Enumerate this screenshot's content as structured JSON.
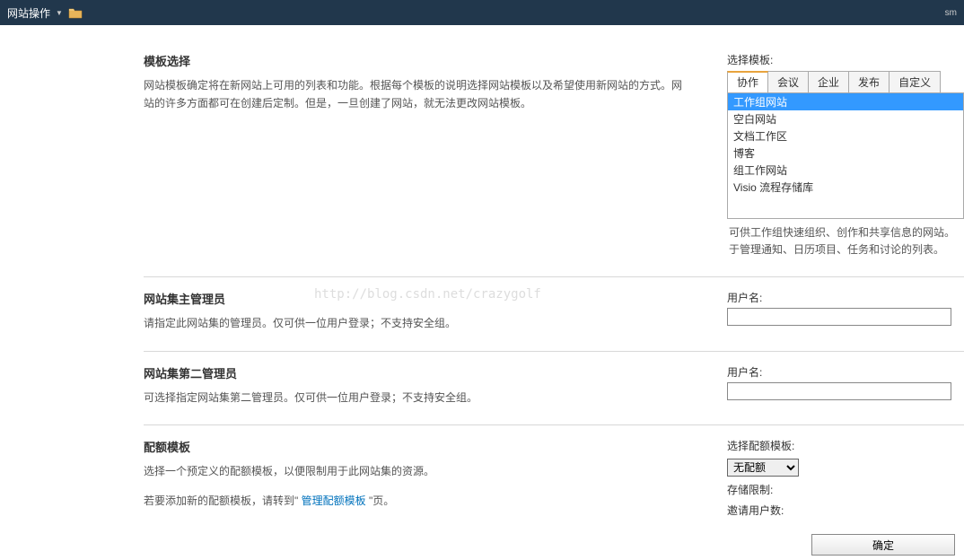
{
  "topbar": {
    "site_actions_label": "网站操作",
    "right_text": "sm"
  },
  "watermark": "http://blog.csdn.net/crazygolf",
  "template_section": {
    "title": "模板选择",
    "desc": "网站模板确定将在新网站上可用的列表和功能。根据每个模板的说明选择网站模板以及希望使用新网站的方式。网站的许多方面都可在创建后定制。但是，一旦创建了网站，就无法更改网站模板。",
    "select_label": "选择模板:",
    "tabs": [
      "协作",
      "会议",
      "企业",
      "发布",
      "自定义"
    ],
    "templates": [
      "工作组网站",
      "空白网站",
      "文档工作区",
      "博客",
      "组工作网站",
      "Visio 流程存储库"
    ],
    "template_desc": "可供工作组快速组织、创作和共享信息的网站。于管理通知、日历项目、任务和讨论的列表。"
  },
  "primary_admin": {
    "title": "网站集主管理员",
    "desc": "请指定此网站集的管理员。仅可供一位用户登录；不支持安全组。",
    "field_label": "用户名:",
    "value": ""
  },
  "secondary_admin": {
    "title": "网站集第二管理员",
    "desc": "可选择指定网站集第二管理员。仅可供一位用户登录；不支持安全组。",
    "field_label": "用户名:",
    "value": ""
  },
  "quota": {
    "title": "配额模板",
    "desc1": "选择一个预定义的配额模板，以便限制用于此网站集的资源。",
    "desc2_prefix": "若要添加新的配额模板，请转到\" ",
    "desc2_link": "管理配额模板",
    "desc2_suffix": " \"页。",
    "select_label": "选择配额模板:",
    "select_value": "无配额",
    "storage_limit_label": "存储限制:",
    "invite_label": "邀请用户数:"
  },
  "footer": {
    "ok_label": "确定"
  }
}
